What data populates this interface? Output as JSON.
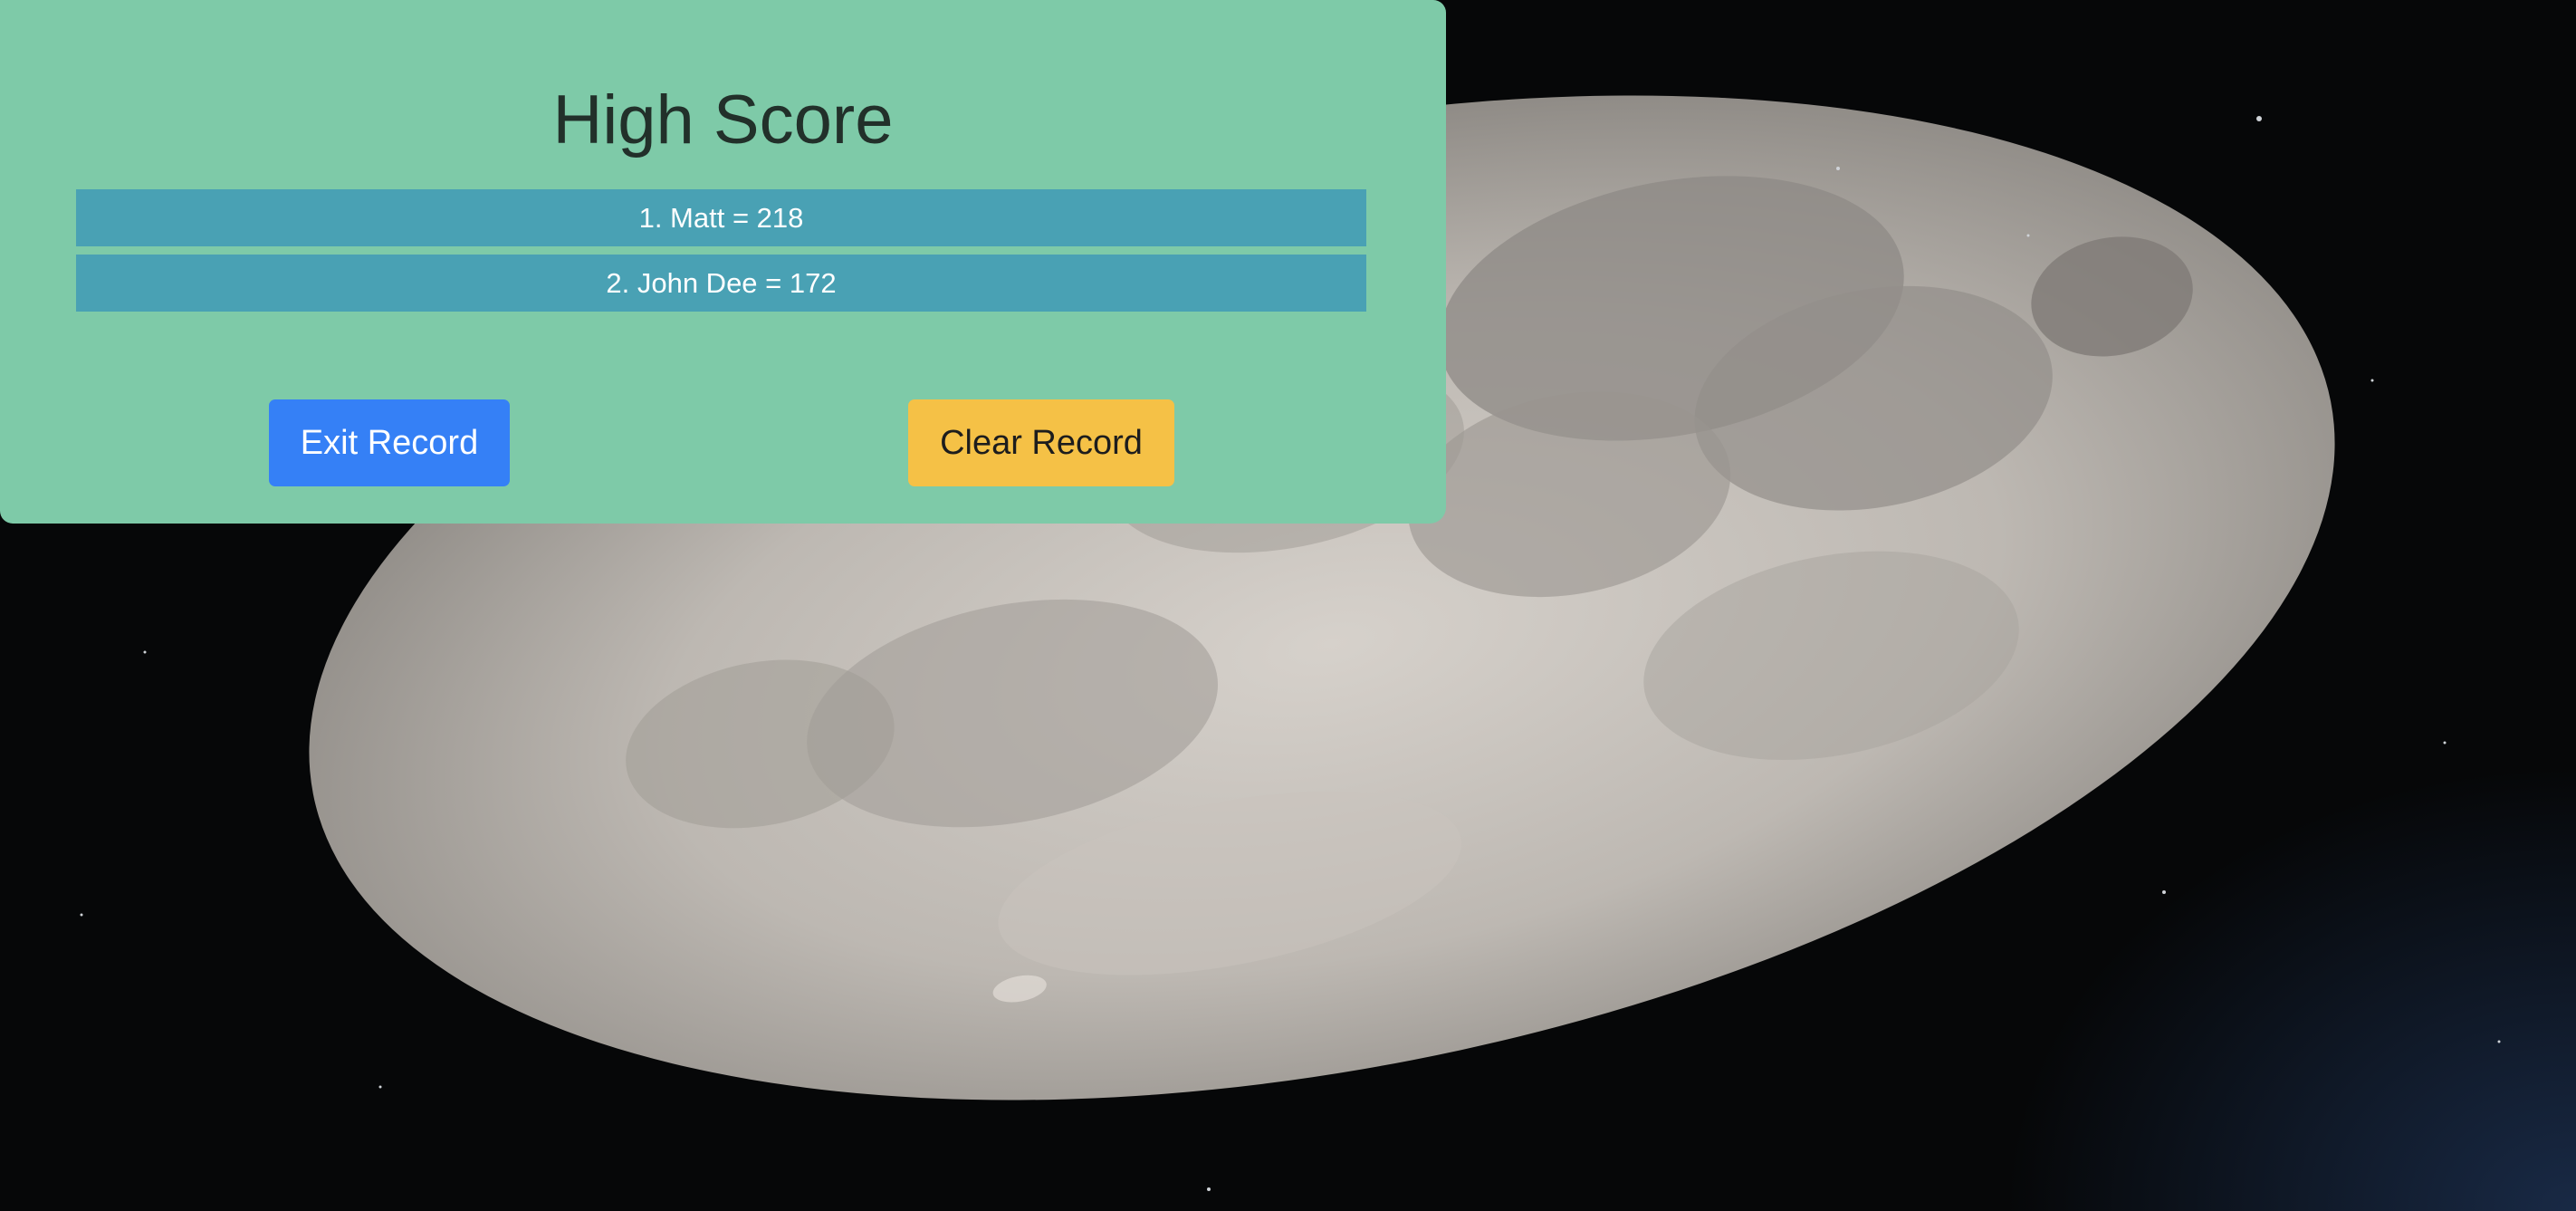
{
  "page": {
    "title": "High Score"
  },
  "scores": [
    {
      "text": "1. Matt = 218"
    },
    {
      "text": "2. John Dee = 172"
    }
  ],
  "buttons": {
    "exit_label": "Exit Record",
    "clear_label": "Clear Record"
  },
  "colors": {
    "panel": "#7ecaa8",
    "score_row": "#49a1b4",
    "exit_button": "#3580f6",
    "clear_button": "#f5c146",
    "title_text": "#22302a"
  },
  "background": {
    "subject": "full-moon-photo"
  }
}
